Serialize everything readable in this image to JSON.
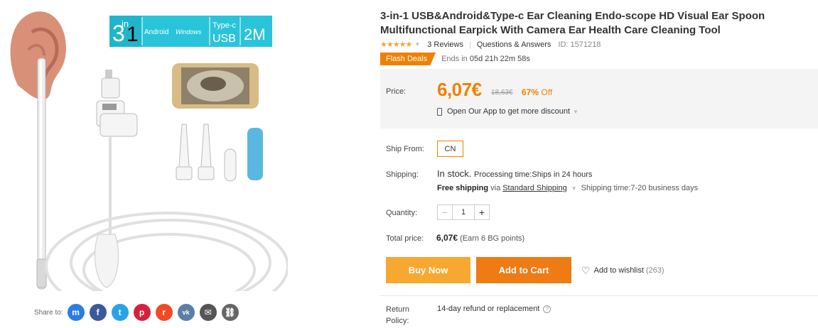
{
  "product_image": {
    "banner_3in1_big": "3",
    "banner_3in1_sub": "in",
    "banner_3in1_one": "1",
    "banner_android": "Android",
    "banner_windows": "Windows",
    "banner_typec": "Type-c",
    "banner_usb": "USB",
    "banner_2m": "2M"
  },
  "share": {
    "label": "Share to:",
    "icons": [
      {
        "name": "messenger-icon",
        "glyph": "m",
        "color": "#2a7de1"
      },
      {
        "name": "facebook-icon",
        "glyph": "f",
        "color": "#3b5998"
      },
      {
        "name": "twitter-icon",
        "glyph": "t",
        "color": "#29a3e6"
      },
      {
        "name": "pinterest-icon",
        "glyph": "p",
        "color": "#d7213b"
      },
      {
        "name": "reddit-icon",
        "glyph": "r",
        "color": "#ef4a23"
      },
      {
        "name": "vk-icon",
        "glyph": "vk",
        "color": "#5b7fa6"
      },
      {
        "name": "email-icon",
        "glyph": "✉",
        "color": "#555555"
      },
      {
        "name": "link-icon",
        "glyph": "⛓",
        "color": "#666666"
      }
    ]
  },
  "product": {
    "title": "3-in-1 USB&Android&Type-c Ear Cleaning Endo-scope HD Visual Ear Spoon Multifunctional Earpick With Camera Ear Health Care Cleaning Tool",
    "stars": "★★★★★",
    "reviews": "3 Reviews",
    "qa": "Questions & Answers",
    "id": "ID: 1571218"
  },
  "flash": {
    "badge": "Flash Deals",
    "ends_label": "Ends in",
    "countdown": "05d 21h 22m 58s"
  },
  "price": {
    "label": "Price:",
    "current": "6,07€",
    "original": "18,63€",
    "discount_pct": "67%",
    "discount_word": "Off",
    "app_promo": "Open Our App to get more discount"
  },
  "shipping": {
    "ship_from_label": "Ship From:",
    "ship_from_value": "CN",
    "label": "Shipping:",
    "stock": "In stock.",
    "processing": "Processing time:Ships in 24 hours",
    "free": "Free shipping",
    "via": "via",
    "method": "Standard Shipping",
    "time": "Shipping time:7-20 business days"
  },
  "quantity": {
    "label": "Quantity:",
    "minus": "−",
    "value": "1",
    "plus": "+"
  },
  "total": {
    "label": "Total price:",
    "amount": "6,07€",
    "points": "(Earn 6 BG points)"
  },
  "actions": {
    "buy_now": "Buy Now",
    "add_to_cart": "Add to Cart",
    "wishlist": "Add to wishlist",
    "wishlist_count": "(263)"
  },
  "return_policy": {
    "label": "Return Policy:",
    "value": "14-day refund or replacement"
  },
  "colors": {
    "accent": "#f08000",
    "buy_now": "#f7a830",
    "add_to_cart": "#ee7b14",
    "banner_cyan": "#29c4d9"
  }
}
